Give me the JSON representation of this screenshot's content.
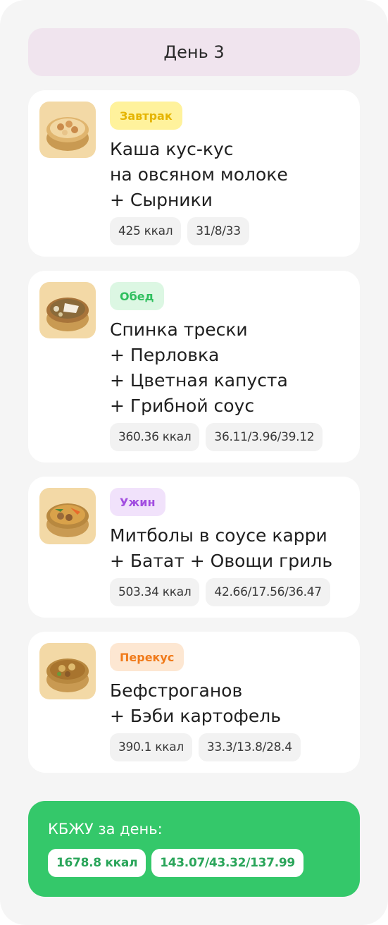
{
  "day_title": "День 3",
  "meals": [
    {
      "tag": "Завтрак",
      "tag_color": "#e5b400",
      "tag_bg": "#fff29c",
      "icon": "couscous-bowl-icon",
      "name_lines": [
        "Каша кус-кус",
        "на овсяном молоке",
        "+ Сырники"
      ],
      "calories": "425 ккал",
      "macros": "31/8/33"
    },
    {
      "tag": "Обед",
      "tag_color": "#2fbf5e",
      "tag_bg": "#dcf7e3",
      "icon": "cod-bowl-icon",
      "name_lines": [
        "Спинка трески",
        "+ Перловка",
        "+ Цветная капуста",
        "+ Грибной соус"
      ],
      "calories": "360.36 ккал",
      "macros": "36.11/3.96/39.12"
    },
    {
      "tag": "Ужин",
      "tag_color": "#a24ee0",
      "tag_bg": "#f1e2fb",
      "icon": "meatballs-bowl-icon",
      "name_lines": [
        "Митболы в соусе карри",
        "+ Батат + Овощи гриль"
      ],
      "calories": "503.34 ккал",
      "macros": "42.66/17.56/36.47"
    },
    {
      "tag": "Перекус",
      "tag_color": "#f07a1a",
      "tag_bg": "#fde7d2",
      "icon": "stroganoff-bowl-icon",
      "name_lines": [
        "Бефстроганов",
        "+ Бэби картофель"
      ],
      "calories": "390.1 ккал",
      "macros": "33.3/13.8/28.4"
    }
  ],
  "summary": {
    "title": "КБЖУ за день:",
    "calories": "1678.8 ккал",
    "macros": "143.07/43.32/137.99"
  }
}
